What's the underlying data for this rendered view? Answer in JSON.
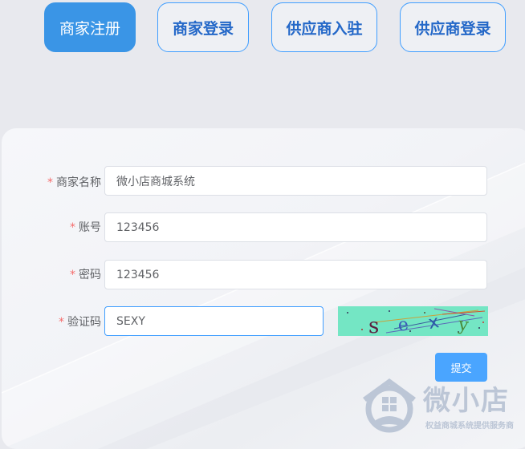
{
  "tabs": [
    {
      "label": "商家注册",
      "active": true
    },
    {
      "label": "商家登录",
      "active": false
    },
    {
      "label": "供应商入驻",
      "active": false
    },
    {
      "label": "供应商登录",
      "active": false
    }
  ],
  "form": {
    "required_mark": "*",
    "merchant_name": {
      "label": "商家名称",
      "value": "微小店商城系统"
    },
    "account": {
      "label": "账号",
      "value": "123456"
    },
    "password": {
      "label": "密码",
      "value": "123456"
    },
    "captcha": {
      "label": "验证码",
      "value": "SEXY",
      "image_chars": [
        "s",
        "e",
        "x",
        "y"
      ]
    },
    "submit_label": "提交"
  },
  "watermark": {
    "brand": "微小店",
    "slogan": "权益商城系统提供服务商"
  },
  "colors": {
    "accent": "#409eff",
    "active_tab": "#3a95e6",
    "tab_text": "#2468c8",
    "required": "#f56c6c",
    "submit": "#4aa5ff",
    "captcha_bg": "#74e6c4",
    "watermark": "#bcc6d6"
  },
  "icons": {
    "watermark_logo": "house-shield-icon"
  }
}
